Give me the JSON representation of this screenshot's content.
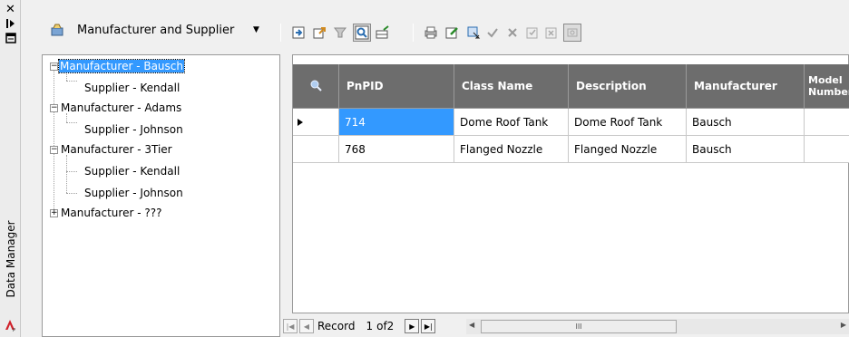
{
  "palette": {
    "title": "Data Manager",
    "close_icon": "close-icon",
    "autohide_icon": "auto-hide-icon",
    "properties_icon": "properties-icon",
    "logo_icon": "autocad-logo"
  },
  "toolbar": {
    "view_label": "Manufacturer and Supplier",
    "colors": {
      "selected": "#3399ff",
      "header": "#6d6d6d"
    }
  },
  "tree": {
    "nodes": [
      {
        "label": "Manufacturer - Bausch",
        "expander": "−",
        "selected": true
      },
      {
        "label": "Supplier - Kendall"
      },
      {
        "label": "Manufacturer - Adams",
        "expander": "−"
      },
      {
        "label": "Supplier - Johnson"
      },
      {
        "label": "Manufacturer - 3Tier",
        "expander": "−"
      },
      {
        "label": "Supplier - Kendall"
      },
      {
        "label": "Supplier - Johnson"
      },
      {
        "label": "Manufacturer - ???",
        "expander": "+"
      }
    ]
  },
  "grid": {
    "columns": [
      "PnPID",
      "Class Name",
      "Description",
      "Manufacturer",
      "Model Number"
    ],
    "rows": [
      {
        "current": true,
        "cells": [
          "714",
          "Dome Roof Tank",
          "Dome Roof Tank",
          "Bausch",
          ""
        ]
      },
      {
        "current": false,
        "cells": [
          "768",
          "Flanged Nozzle",
          "Flanged Nozzle",
          "Bausch",
          ""
        ]
      }
    ]
  },
  "nav": {
    "record_label": "Record",
    "position": "1",
    "of_label": "of2",
    "scroll_grip": "III"
  }
}
